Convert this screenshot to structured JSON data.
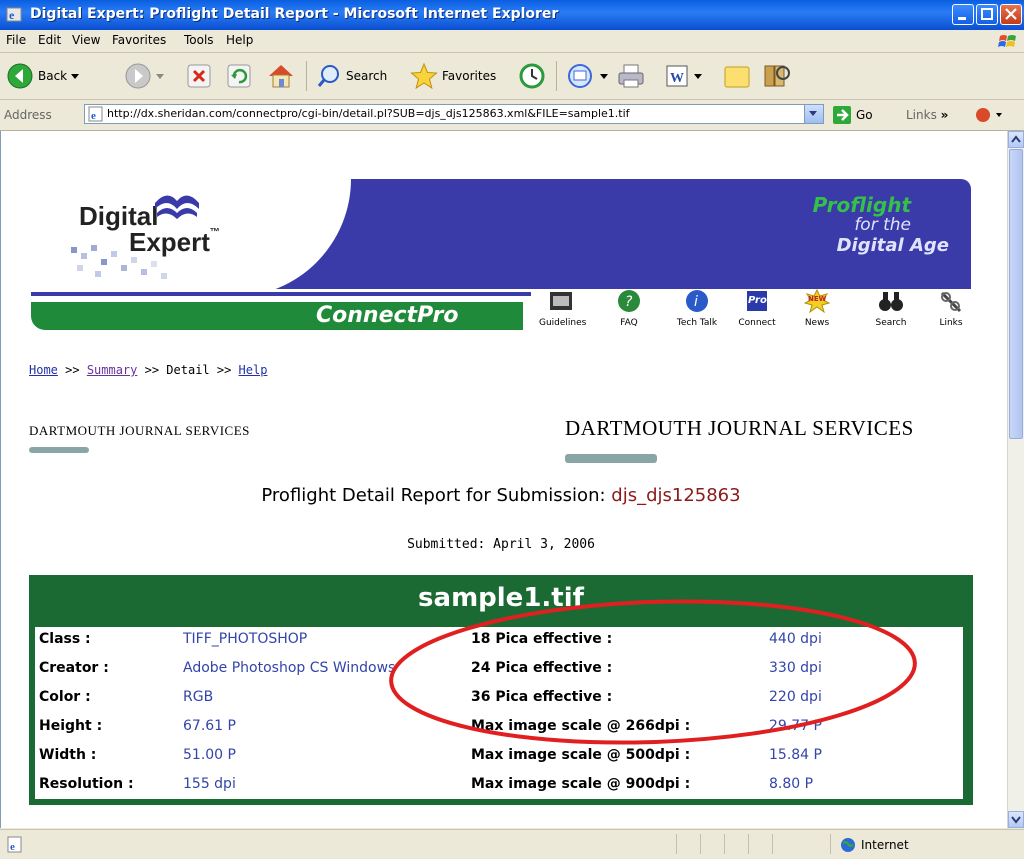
{
  "window": {
    "title": "Digital Expert: Proflight Detail Report - Microsoft Internet Explorer"
  },
  "menu": {
    "items": [
      "File",
      "Edit",
      "View",
      "Favorites",
      "Tools",
      "Help"
    ]
  },
  "toolbar": {
    "back": "Back",
    "search": "Search",
    "favorites": "Favorites"
  },
  "address": {
    "label": "Address",
    "url": "http://dx.sheridan.com/connectpro/cgi-bin/detail.pl?SUB=djs_djs125863.xml&FILE=sample1.tif",
    "go": "Go",
    "links": "Links"
  },
  "banner": {
    "logo_line1": "Digital",
    "logo_line2": "Expert",
    "tm": "™",
    "tagline1": "Proflight",
    "tagline2": "for the",
    "tagline3": "Digital Age",
    "connectpro": "ConnectPro",
    "nav": [
      "Guidelines",
      "FAQ",
      "Tech Talk",
      "Connect",
      "News",
      "Search",
      "Links"
    ],
    "news_badge": "NEW",
    "connect_badge": "Pro"
  },
  "breadcrumb": {
    "home": "Home",
    "sep1": " >> ",
    "summary": "Summary",
    "sep2": " >> Detail >> ",
    "help": "Help"
  },
  "publisher": {
    "name": "DARTMOUTH JOURNAL SERVICES"
  },
  "report": {
    "title_prefix": "Proflight Detail Report for Submission: ",
    "submission_id": "djs_djs125863",
    "submitted": "Submitted: April 3, 2006",
    "filename": "sample1.tif",
    "rows": [
      {
        "k1": "Class :",
        "v1": "TIFF_PHOTOSHOP",
        "k2": "18 Pica effective :",
        "v2": "440 dpi"
      },
      {
        "k1": "Creator :",
        "v1": "Adobe Photoshop CS Windows",
        "k2": "24 Pica effective :",
        "v2": "330 dpi"
      },
      {
        "k1": "Color :",
        "v1": "RGB",
        "k2": "36 Pica effective :",
        "v2": "220 dpi"
      },
      {
        "k1": "Height :",
        "v1": "67.61 P",
        "k2": "Max image scale @ 266dpi :",
        "v2": "29.77 P"
      },
      {
        "k1": "Width :",
        "v1": "51.00 P",
        "k2": "Max image scale @ 500dpi :",
        "v2": "15.84 P"
      },
      {
        "k1": "Resolution :",
        "v1": "155 dpi",
        "k2": "Max image scale @ 900dpi :",
        "v2": "8.80 P"
      }
    ]
  },
  "status": {
    "zone": "Internet"
  },
  "colors": {
    "title_blue": "#0a5fe0",
    "banner_blue": "#3a3aa8",
    "banner_green": "#1f8a3a",
    "panel_green": "#1b6a33",
    "highlight_red": "#e02020",
    "id_red": "#8b1a1a"
  }
}
